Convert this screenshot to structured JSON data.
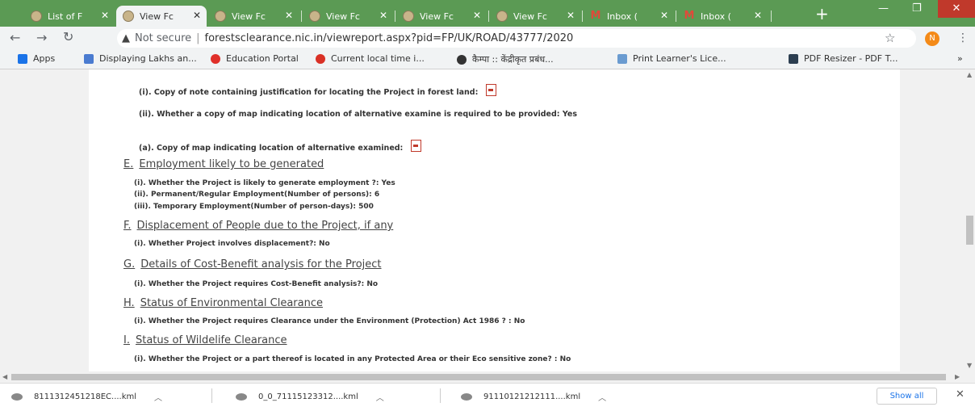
{
  "browser": {
    "tabs": [
      {
        "title": "List of F",
        "active": false
      },
      {
        "title": "View Fc",
        "active": true
      },
      {
        "title": "View Fc",
        "active": false
      },
      {
        "title": "View Fc",
        "active": false
      },
      {
        "title": "View Fc",
        "active": false
      },
      {
        "title": "View Fc",
        "active": false
      },
      {
        "title": "Inbox (",
        "active": false
      },
      {
        "title": "Inbox (",
        "active": false
      }
    ],
    "security_label": "Not secure",
    "url": "forestsclearance.nic.in/viewreport.aspx?pid=FP/UK/ROAD/43777/2020",
    "profile_initial": "N",
    "bookmarks": [
      "Apps",
      "Displaying Lakhs an...",
      "Education Portal",
      "Current local time i...",
      "कैम्पा :: केंद्रीकृत प्रबंध...",
      "Print Learner's Lice...",
      "PDF Resizer - PDF T..."
    ],
    "bookmarks_more": "»"
  },
  "report": {
    "intro_items": [
      "(i). Copy of note containing justification for locating the Project in forest land:",
      "(ii). Whether a copy of map indicating location of alternative examine is required to be provided: Yes",
      "(a). Copy of map indicating location of alternative examined:"
    ],
    "sections": [
      {
        "letter": "E.",
        "title": "Employment likely to be generated",
        "items": [
          "(i). Whether the Project is likely to generate employment ?: Yes",
          "(ii). Permanent/Regular Employment(Number of persons): 6",
          "(iii). Temporary Employment(Number of person-days): 500"
        ]
      },
      {
        "letter": "F.",
        "title": "Displacement of People due to the Project, if any",
        "items": [
          "(i). Whether Project involves displacement?: No"
        ]
      },
      {
        "letter": "G.",
        "title": "Details of Cost-Benefit analysis for the Project",
        "items": [
          "(i). Whether the Project requires Cost-Benefit analysis?: No"
        ]
      },
      {
        "letter": "H.",
        "title": "Status of Environmental Clearance",
        "items": [
          "(i). Whether the Project requires Clearance under the Environment (Protection) Act 1986 ? : No"
        ]
      },
      {
        "letter": "I.",
        "title": "Status of Wildelife Clearance",
        "items": [
          "(i). Whether the Project or a part thereof is located in any Protected Area or their Eco sensitive zone? : No"
        ]
      }
    ]
  },
  "downloads": {
    "files": [
      "8111312451218EC....kml",
      "0_0_71115123312....kml",
      "91110121212111....kml"
    ],
    "show_all": "Show all"
  }
}
